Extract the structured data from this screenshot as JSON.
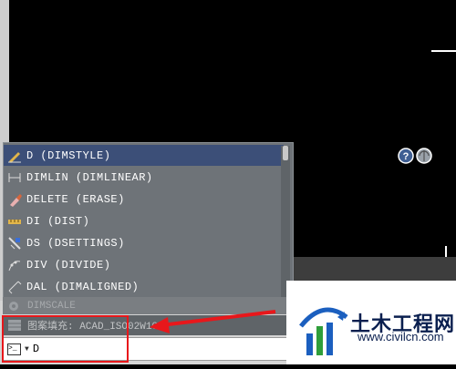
{
  "autocomplete": {
    "items": [
      {
        "label": "D (DIMSTYLE)",
        "icon": "dimstyle-icon",
        "selected": true
      },
      {
        "label": "DIMLIN (DIMLINEAR)",
        "icon": "dim-linear-icon"
      },
      {
        "label": "DELETE (ERASE)",
        "icon": "erase-icon"
      },
      {
        "label": "DI (DIST)",
        "icon": "distance-icon"
      },
      {
        "label": "DS (DSETTINGS)",
        "icon": "drafting-settings-icon"
      },
      {
        "label": "DIV (DIVIDE)",
        "icon": "divide-icon"
      },
      {
        "label": "DAL (DIMALIGNED)",
        "icon": "dim-aligned-icon"
      }
    ]
  },
  "history": [
    {
      "text": "DIMSCALE"
    },
    {
      "text": "图案填充: ACAD_ISO02W100"
    }
  ],
  "command": {
    "value": "D"
  },
  "watermark": {
    "title": "土木工程网",
    "url": "www.civilcn.com"
  },
  "colors": {
    "highlight": "#e8171b",
    "selected": "#3c4f78",
    "logo_blue": "#1b5fbf",
    "logo_green": "#2f9e3a"
  }
}
